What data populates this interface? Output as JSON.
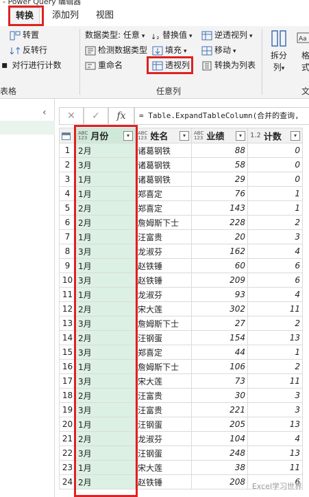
{
  "window": {
    "title": "- Power Query 编辑器"
  },
  "tabs": [
    {
      "label": "转换",
      "active": true
    },
    {
      "label": "添加列",
      "active": false
    },
    {
      "label": "视图",
      "active": false
    }
  ],
  "ribbon": {
    "table_group": {
      "label": "表格",
      "items": [
        "转置",
        "反转行",
        "对行进行计数"
      ]
    },
    "any_column_group": {
      "label": "任意列",
      "data_type": "数据类型: 任意",
      "replace_values": "替换值",
      "unpivot": "逆透视列",
      "detect_type": "检测数据类型",
      "fill": "填充",
      "move": "移动",
      "rename": "重命名",
      "pivot": "透视列",
      "convert_to_list": "转换为列表"
    },
    "split_column": {
      "line1": "拆分",
      "line2": "列"
    },
    "format": {
      "line1": "格",
      "line2": "式"
    },
    "text_group_label": "文"
  },
  "formula_bar": {
    "formula": "= Table.ExpandTableColumn(合并的查询,"
  },
  "table": {
    "columns": [
      {
        "type_line1": "ABC",
        "type_line2": "123",
        "name": "月份"
      },
      {
        "type_line1": "ABC",
        "type_line2": "123",
        "name": "姓名"
      },
      {
        "type_line1": "ABC",
        "type_line2": "123",
        "name": "业绩"
      },
      {
        "type_line1": "1.2",
        "type_line2": "",
        "name": "计数"
      }
    ],
    "rows": [
      [
        "1",
        "2月",
        "诸葛钢铁",
        "88",
        "0"
      ],
      [
        "2",
        "3月",
        "诸葛钢铁",
        "58",
        "0"
      ],
      [
        "3",
        "1月",
        "诸葛钢铁",
        "29",
        "0"
      ],
      [
        "4",
        "1月",
        "郑喜定",
        "76",
        "1"
      ],
      [
        "5",
        "2月",
        "郑喜定",
        "143",
        "1"
      ],
      [
        "6",
        "2月",
        "詹姆斯下士",
        "228",
        "2"
      ],
      [
        "7",
        "1月",
        "汪富贵",
        "20",
        "3"
      ],
      [
        "8",
        "3月",
        "龙淑芬",
        "162",
        "4"
      ],
      [
        "9",
        "1月",
        "赵铁锤",
        "60",
        "6"
      ],
      [
        "10",
        "3月",
        "赵铁锤",
        "209",
        "6"
      ],
      [
        "11",
        "1月",
        "龙淑芬",
        "93",
        "4"
      ],
      [
        "12",
        "2月",
        "宋大莲",
        "302",
        "11"
      ],
      [
        "13",
        "3月",
        "詹姆斯下士",
        "27",
        "2"
      ],
      [
        "14",
        "2月",
        "汪钢蛋",
        "154",
        "13"
      ],
      [
        "15",
        "3月",
        "郑喜定",
        "44",
        "1"
      ],
      [
        "16",
        "1月",
        "詹姆斯下士",
        "106",
        "2"
      ],
      [
        "17",
        "3月",
        "宋大莲",
        "73",
        "11"
      ],
      [
        "18",
        "2月",
        "汪富贵",
        "30",
        "3"
      ],
      [
        "19",
        "3月",
        "汪富贵",
        "221",
        "3"
      ],
      [
        "20",
        "1月",
        "汪钢蛋",
        "205",
        "13"
      ],
      [
        "21",
        "2月",
        "龙淑芬",
        "104",
        "4"
      ],
      [
        "22",
        "3月",
        "汪钢蛋",
        "248",
        "13"
      ],
      [
        "23",
        "1月",
        "宋大莲",
        "38",
        "11"
      ],
      [
        "24",
        "2月",
        "赵铁锤",
        "208",
        "6"
      ]
    ]
  },
  "watermark": "Excel学习世界",
  "colors": {
    "highlight": "#e02020",
    "selected_column": "#dcf1e4"
  }
}
